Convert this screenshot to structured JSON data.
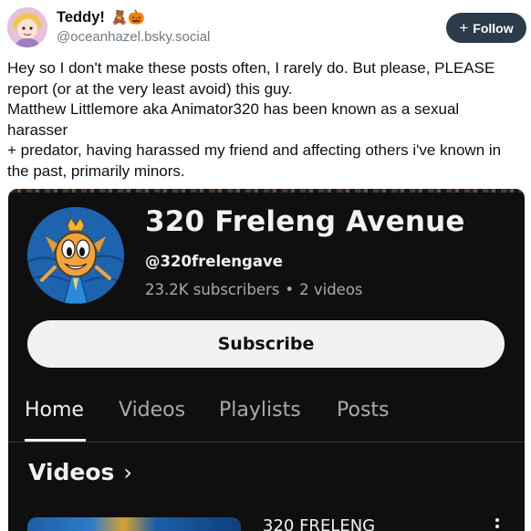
{
  "author": {
    "display_name": "Teddy!",
    "emoji": "🧸🎃",
    "handle": "@oceanhazel.bsky.social"
  },
  "follow_button": {
    "icon": "plus-icon",
    "label": "Follow"
  },
  "post": {
    "lines": [
      "Hey so I don't make these posts often, I rarely do. But please, PLEASE report (or at the very least avoid) this guy.",
      "Matthew Littlemore aka Animator320 has been known as a sexual harasser",
      "+ predator, having harassed my friend and affecting others i've known in the past, primarily minors."
    ]
  },
  "embed": {
    "channel_name": "320 Freleng Avenue",
    "channel_handle": "@320frelengave",
    "subscribers": "23.2K subscribers",
    "separator": "•",
    "video_count": "2 videos",
    "subscribe_label": "Subscribe",
    "tabs": [
      "Home",
      "Videos",
      "Playlists",
      "Posts"
    ],
    "active_tab": "Home",
    "section_title": "Videos",
    "section_chevron": "›",
    "video_title": "320 FRELENG",
    "colors": {
      "background": "#0f0f0f",
      "text": "#f1f1f1",
      "muted": "#aaaaaa",
      "avatar_bg": "#1d63ad"
    }
  },
  "colors": {
    "follow_button_bg": "#2c3b4a",
    "handle": "#6f7b86"
  }
}
